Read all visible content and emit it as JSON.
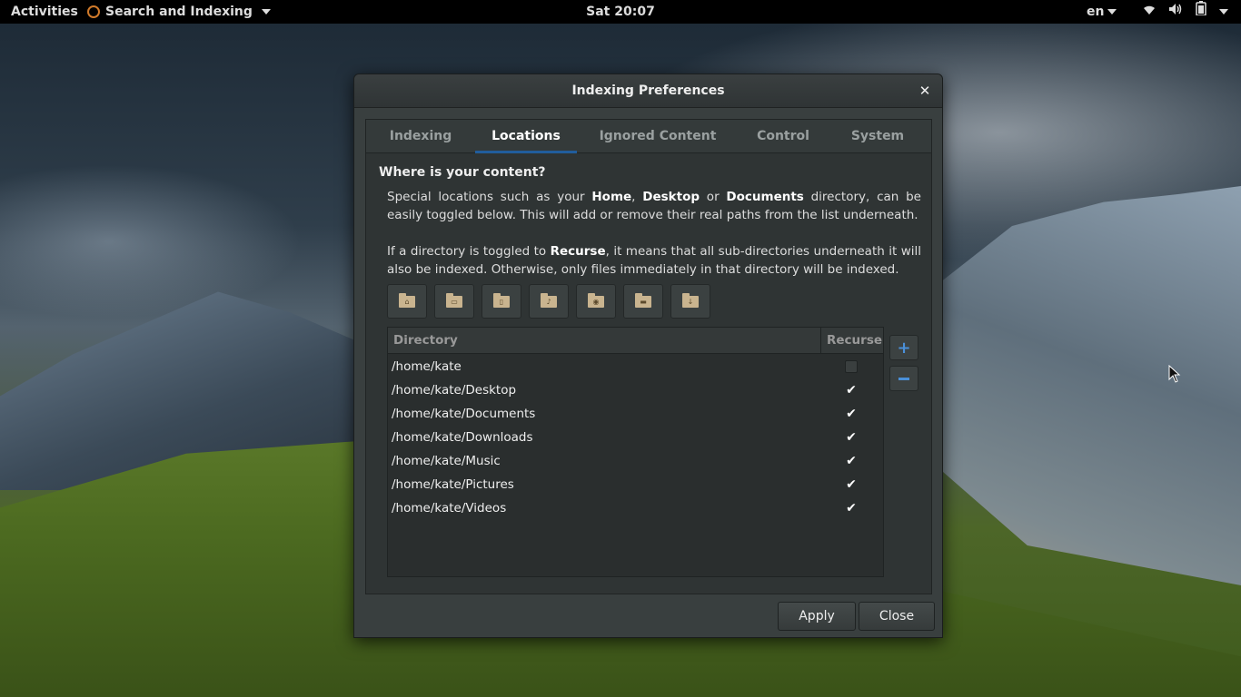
{
  "topbar": {
    "activities": "Activities",
    "app_name": "Search and Indexing",
    "clock": "Sat 20:07",
    "language": "en",
    "icons": [
      "wifi-icon",
      "volume-icon",
      "battery-icon",
      "power-menu-icon"
    ]
  },
  "dialog": {
    "title": "Indexing Preferences",
    "tabs": [
      "Indexing",
      "Locations",
      "Ignored Content",
      "Control",
      "System"
    ],
    "active_tab": "Locations",
    "heading": "Where is your content?",
    "para1": {
      "t1": "Special locations such as your ",
      "b1": "Home",
      "t2": ", ",
      "b2": "Desktop",
      "t3": " or ",
      "b3": "Documents",
      "t4": " directory, can be easily toggled below. This will add or remove their real paths from the list underneath."
    },
    "para2": {
      "t1": "If a directory is toggled to ",
      "b1": "Recurse",
      "t2": ", it means that all sub-directories underneath it will also be indexed. Otherwise, only files immediately in that directory will be indexed."
    },
    "shortcut_icons": [
      "home-folder-icon",
      "desktop-folder-icon",
      "documents-folder-icon",
      "music-folder-icon",
      "pictures-folder-icon",
      "videos-folder-icon",
      "downloads-folder-icon"
    ],
    "table": {
      "col_directory": "Directory",
      "col_recurse": "Recurse",
      "rows": [
        {
          "path": "/home/kate",
          "recurse": false
        },
        {
          "path": "/home/kate/Desktop",
          "recurse": true
        },
        {
          "path": "/home/kate/Documents",
          "recurse": true
        },
        {
          "path": "/home/kate/Downloads",
          "recurse": true
        },
        {
          "path": "/home/kate/Music",
          "recurse": true
        },
        {
          "path": "/home/kate/Pictures",
          "recurse": true
        },
        {
          "path": "/home/kate/Videos",
          "recurse": true
        }
      ]
    },
    "add_label": "+",
    "apply_label": "Apply",
    "close_label": "Close",
    "accent_color": "#215d9c"
  }
}
